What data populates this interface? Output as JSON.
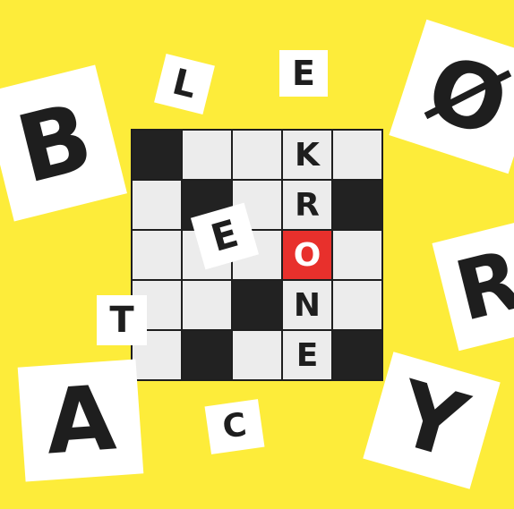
{
  "colors": {
    "background": "#fdec3a",
    "tile": "#ffffff",
    "cell": "#ececec",
    "black_cell": "#222222",
    "highlight": "#e8302c",
    "ink": "#1e1e1e"
  },
  "grid": {
    "rows": 5,
    "cols": 5,
    "cells": [
      {
        "r": 0,
        "c": 0,
        "type": "black",
        "letter": ""
      },
      {
        "r": 0,
        "c": 1,
        "type": "empty",
        "letter": ""
      },
      {
        "r": 0,
        "c": 2,
        "type": "empty",
        "letter": ""
      },
      {
        "r": 0,
        "c": 3,
        "type": "letter",
        "letter": "K"
      },
      {
        "r": 0,
        "c": 4,
        "type": "empty",
        "letter": ""
      },
      {
        "r": 1,
        "c": 0,
        "type": "empty",
        "letter": ""
      },
      {
        "r": 1,
        "c": 1,
        "type": "black",
        "letter": ""
      },
      {
        "r": 1,
        "c": 2,
        "type": "empty",
        "letter": ""
      },
      {
        "r": 1,
        "c": 3,
        "type": "letter",
        "letter": "R"
      },
      {
        "r": 1,
        "c": 4,
        "type": "black",
        "letter": ""
      },
      {
        "r": 2,
        "c": 0,
        "type": "empty",
        "letter": ""
      },
      {
        "r": 2,
        "c": 1,
        "type": "empty",
        "letter": ""
      },
      {
        "r": 2,
        "c": 2,
        "type": "empty",
        "letter": ""
      },
      {
        "r": 2,
        "c": 3,
        "type": "highlight",
        "letter": "O"
      },
      {
        "r": 2,
        "c": 4,
        "type": "empty",
        "letter": ""
      },
      {
        "r": 3,
        "c": 0,
        "type": "empty",
        "letter": ""
      },
      {
        "r": 3,
        "c": 1,
        "type": "empty",
        "letter": ""
      },
      {
        "r": 3,
        "c": 2,
        "type": "black",
        "letter": ""
      },
      {
        "r": 3,
        "c": 3,
        "type": "letter",
        "letter": "N"
      },
      {
        "r": 3,
        "c": 4,
        "type": "empty",
        "letter": ""
      },
      {
        "r": 4,
        "c": 0,
        "type": "empty",
        "letter": ""
      },
      {
        "r": 4,
        "c": 1,
        "type": "black",
        "letter": ""
      },
      {
        "r": 4,
        "c": 2,
        "type": "empty",
        "letter": ""
      },
      {
        "r": 4,
        "c": 3,
        "type": "letter",
        "letter": "E"
      },
      {
        "r": 4,
        "c": 4,
        "type": "black",
        "letter": ""
      }
    ]
  },
  "tiles": {
    "b": "B",
    "l": "L",
    "e_top": "E",
    "o_slash": "Ø",
    "e_mid": "E",
    "r": "R",
    "t": "T",
    "a": "A",
    "c": "C",
    "y": "Y"
  }
}
